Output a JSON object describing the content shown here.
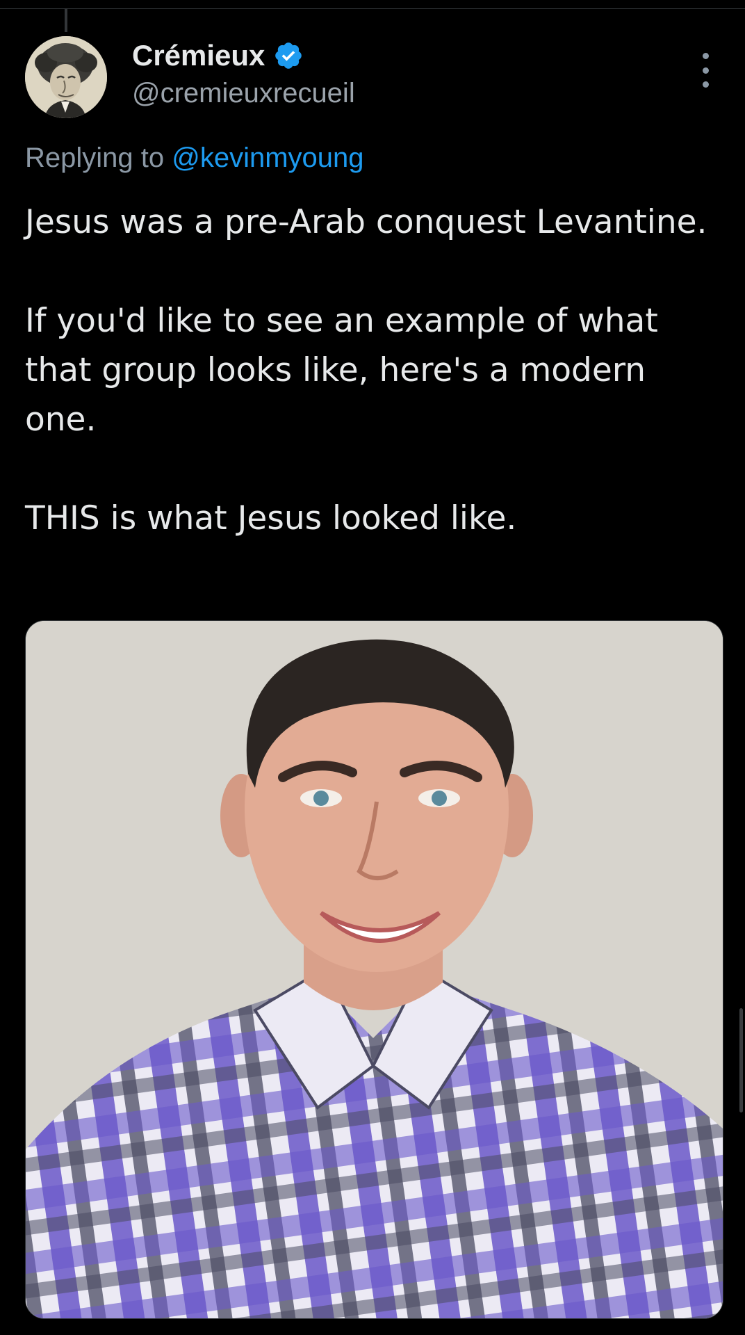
{
  "tweet": {
    "author": {
      "display_name": "Crémieux",
      "handle": "@cremieuxrecueil",
      "verified": true,
      "avatar": "caricature-portrait"
    },
    "replying_prefix": "Replying to",
    "replying_to": "@kevinmyoung",
    "paragraphs": [
      "Jesus was a pre-Arab conquest Levantine.",
      "If you'd like to see an example of what that group looks like, here's a modern one.",
      "THIS is what Jesus looked like."
    ],
    "media": {
      "kind": "photo",
      "subject": "smiling man in plaid shirt"
    },
    "more_menu_icon": "more-vertical-icon"
  },
  "theme": {
    "background": "#000000",
    "text": "#e7e9ea",
    "muted": "#8b98a5",
    "accent": "#1d9bf0"
  }
}
